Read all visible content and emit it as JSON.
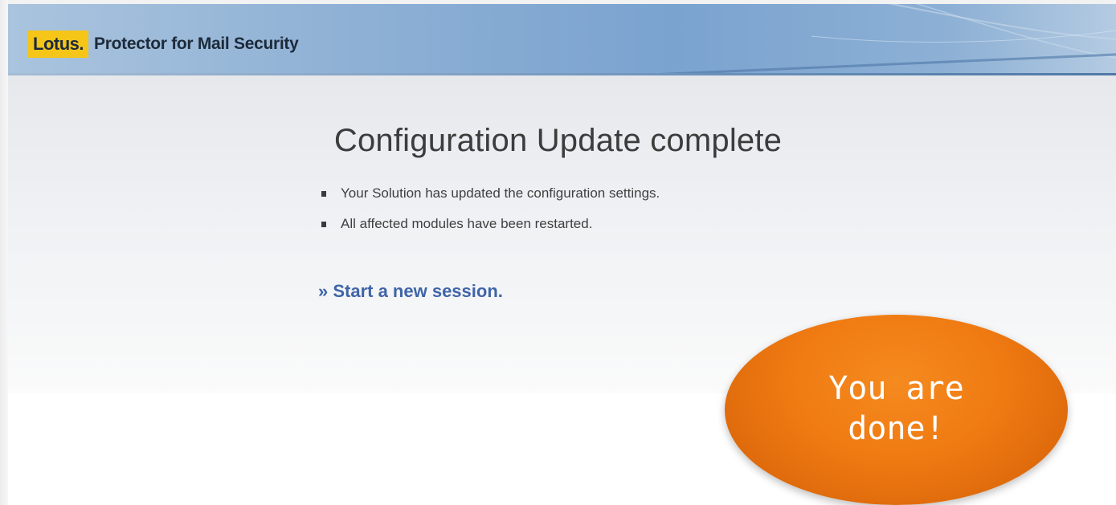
{
  "header": {
    "brand_mark": "Lotus",
    "brand_dot": ".",
    "product_name": "Protector for Mail Security"
  },
  "main": {
    "title": "Configuration Update complete",
    "bullets": [
      "Your Solution has updated the configuration settings.",
      "All affected modules have been restarted."
    ],
    "link_text": "» Start a new session."
  },
  "callout": {
    "text": "You are done!"
  },
  "colors": {
    "brand_yellow": "#f5c518",
    "banner_blue": "#7aa3cf",
    "link_blue": "#3f64a8",
    "callout_orange": "#ef7a12"
  }
}
